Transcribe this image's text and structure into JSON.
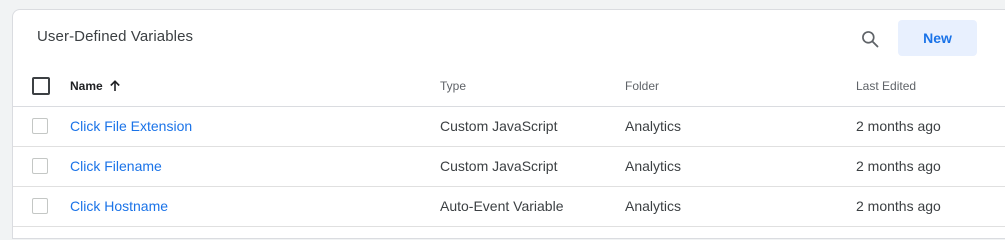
{
  "card": {
    "title": "User-Defined Variables",
    "new_label": "New",
    "search_icon": "search-icon"
  },
  "table": {
    "headers": {
      "name": "Name",
      "type": "Type",
      "folder": "Folder",
      "last_edited": "Last Edited"
    },
    "sort_icon": "arrow-up-icon",
    "rows": [
      {
        "name": "Click File Extension",
        "type": "Custom JavaScript",
        "folder": "Analytics",
        "last_edited": "2 months ago"
      },
      {
        "name": "Click Filename",
        "type": "Custom JavaScript",
        "folder": "Analytics",
        "last_edited": "2 months ago"
      },
      {
        "name": "Click Hostname",
        "type": "Auto-Event Variable",
        "folder": "Analytics",
        "last_edited": "2 months ago"
      }
    ]
  },
  "colors": {
    "accent": "#1a73e8",
    "button_bg": "#e8f0fe",
    "background": "#f1f3f4"
  }
}
